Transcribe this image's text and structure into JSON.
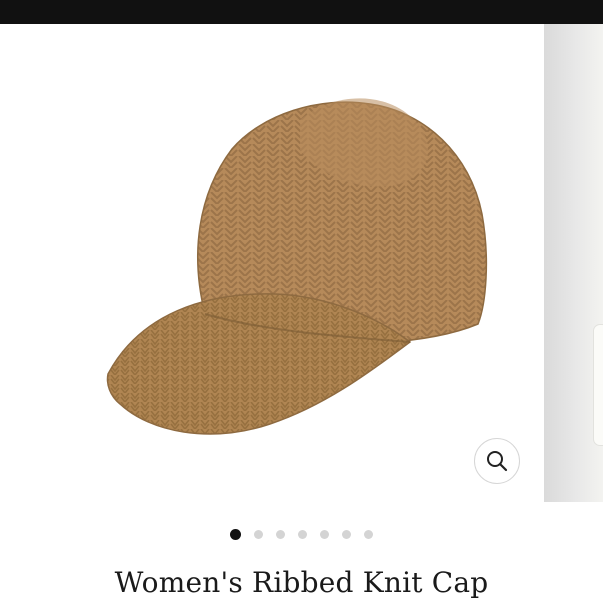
{
  "product": {
    "title": "Women's Ribbed Knit Cap",
    "image_subject": "tan ribbed knit baseball cap",
    "accent_color": "#b68a5a"
  },
  "gallery": {
    "total_slides": 7,
    "active_slide": 1,
    "zoom_icon": "magnifier-icon"
  }
}
